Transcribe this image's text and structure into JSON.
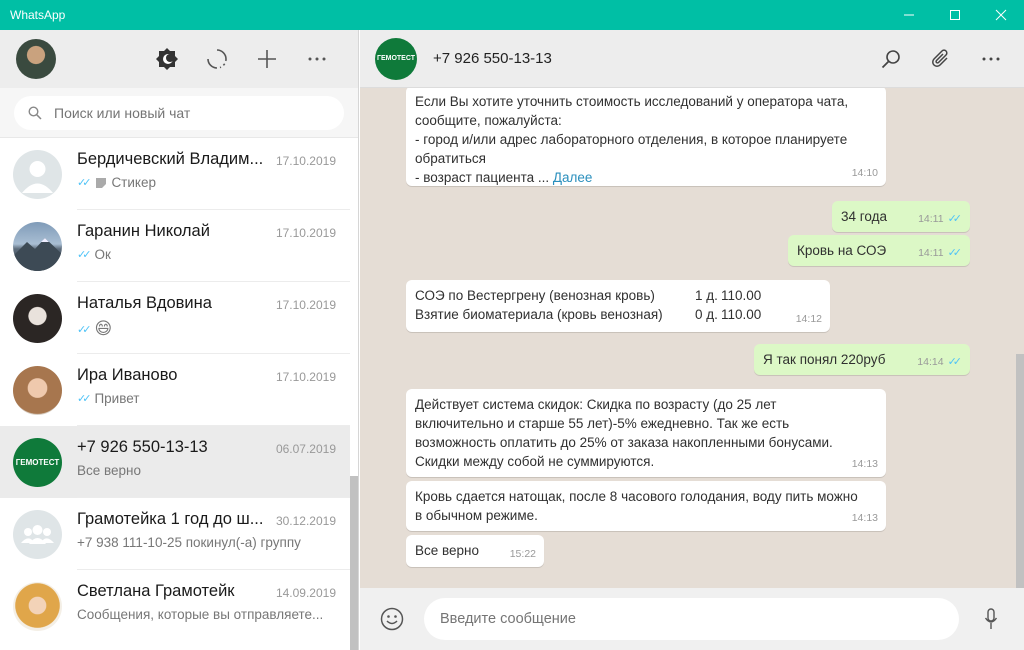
{
  "window": {
    "title": "WhatsApp",
    "minimize": "—",
    "maximize": "☐",
    "close": "✕"
  },
  "search": {
    "placeholder": "Поиск или новый чат"
  },
  "chats": [
    {
      "name": "Бердичевский Владим...",
      "date": "17.10.2019",
      "preview": "Стикер",
      "ticks": true,
      "sticker": true,
      "avatar": "default-user"
    },
    {
      "name": "Гаранин Николай",
      "date": "17.10.2019",
      "preview": "Ок",
      "ticks": true,
      "avatar": "mountain"
    },
    {
      "name": "Наталья Вдовина",
      "date": "17.10.2019",
      "preview": "😄",
      "ticks": true,
      "avatar": "woman-dark"
    },
    {
      "name": "Ира Иваново",
      "date": "17.10.2019",
      "preview": "Привет",
      "ticks": true,
      "avatar": "woman-light"
    },
    {
      "name": "+7 926 550-13-13",
      "date": "06.07.2019",
      "preview": "Все верно",
      "ticks": false,
      "avatar": "gemotest",
      "active": true
    },
    {
      "name": "Грамотейка 1 год до ш...",
      "date": "30.12.2019",
      "preview": "+7 938 111-10-25 покинул(-а) группу",
      "ticks": false,
      "avatar": "group"
    },
    {
      "name": "Светлана Грамотейк",
      "date": "14.09.2019",
      "preview": "Сообщения, которые вы отправляете...",
      "ticks": false,
      "avatar": "woman-blonde"
    }
  ],
  "conversation": {
    "contact": "+7 926 550-13-13",
    "avatar_text": "ГЕМОТЕСТ",
    "messages": [
      {
        "dir": "in",
        "lines": [
          "Если Вы хотите уточнить стоимость исследований у оператора чата,",
          "сообщите, пожалуйста:",
          "- город и/или адрес лабораторного отделения, в которое планируете",
          "обратиться",
          "- возраст пациента ..."
        ],
        "more": "Далее",
        "time": "14:10"
      },
      {
        "dir": "out",
        "text": "34 года",
        "time": "14:11"
      },
      {
        "dir": "out",
        "text": "Кровь на СОЭ",
        "time": "14:11"
      },
      {
        "dir": "in",
        "rows": [
          [
            "СОЭ по Вестергрену (венозная кровь)",
            "1 д.",
            "110.00"
          ],
          [
            "Взятие биоматериала (кровь венозная)",
            "0 д.",
            "110.00"
          ]
        ],
        "time": "14:12"
      },
      {
        "dir": "out",
        "text": "Я так понял 220руб",
        "time": "14:14"
      },
      {
        "dir": "in",
        "lines": [
          "Действует система скидок: Скидка по возрасту (до 25 лет",
          "включительно и старше 55 лет)-5% ежедневно. Так же есть",
          "возможность оплатить до 25% от заказа накопленными бонусами.",
          "Скидки между собой не суммируются."
        ],
        "time": "14:13"
      },
      {
        "dir": "in",
        "lines": [
          "Кровь сдается натощак, после 8 часового голодания, воду пить можно",
          "в обычном режиме."
        ],
        "time": "14:13"
      },
      {
        "dir": "in",
        "text": "Все верно",
        "time": "15:22"
      }
    ]
  },
  "composer": {
    "placeholder": "Введите сообщение"
  },
  "colors": {
    "accent": "#00bfa5",
    "outgoing": "#dcf8c6",
    "chat_bg": "#e5ddd5",
    "tick": "#4fc3f7"
  }
}
